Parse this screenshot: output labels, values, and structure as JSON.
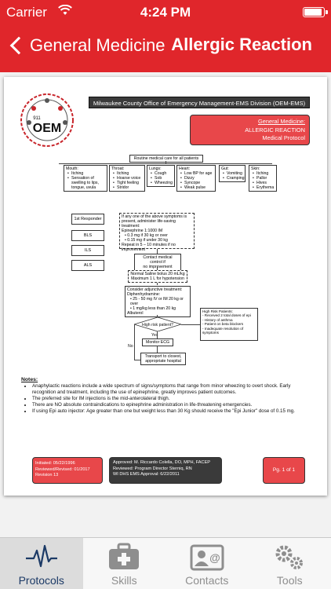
{
  "status": {
    "carrier": "Carrier",
    "time": "4:24 PM",
    "battery_level": 0.95
  },
  "nav": {
    "back_label": "General Medicine",
    "title": "Allergic Reaction"
  },
  "document": {
    "logo_text": "OEM",
    "logo_small": "911",
    "org_banner": "Milwaukee County Office of Emergency Management-EMS Division (OEM-EMS)",
    "protocol_box": {
      "line1": "General Medicine:",
      "line2": "ALLERGIC REACTION",
      "line3": "Medical Protocol"
    },
    "flow": {
      "routine": "Routine medical care for all patients",
      "symptom_groups": [
        {
          "title": "Mouth:",
          "items": [
            "Itching",
            "Sensation of swelling to lips, tongue, uvula"
          ]
        },
        {
          "title": "Throat:",
          "items": [
            "Itching",
            "Hoarse voice",
            "Tight feeling",
            "Stridor"
          ]
        },
        {
          "title": "Lungs:",
          "items": [
            "Cough",
            "Sob",
            "Wheezing"
          ]
        },
        {
          "title": "Heart:",
          "items": [
            "Low BP for age",
            "Dizzy",
            "Syncope",
            "Weak pulse"
          ]
        },
        {
          "title": "Gut:",
          "items": [
            "Vomiting",
            "Cramping"
          ]
        },
        {
          "title": "Skin:",
          "items": [
            "Itching",
            "Pallor",
            "Hives",
            "Erythema"
          ]
        }
      ],
      "responders": [
        "1st Responder",
        "BLS",
        "ILS",
        "ALS"
      ],
      "epi_box": [
        "If any one of the above symptoms is present, administer life-saving treatment:",
        "Epinephrine 1:1000 IM",
        "0.3 mg if 30 kg or over",
        "0.15 mg if under 30 kg",
        "Repeat in 5 – 10 minutes if no improvement"
      ],
      "contact_box": [
        "Contact medical control if",
        "no improvement"
      ],
      "saline_box": [
        "Normal Saline bolus 20 mL/kg",
        "Maximum 1 L for hypotension"
      ],
      "adjunct_box": [
        "Consider adjunctive treatment:",
        "Diphenhydramine:",
        "25 - 50 mg IV or IM 20 kg or over",
        "1 mg/kg less than 20 kg",
        "Albuterol"
      ],
      "decision": "High risk patient?",
      "decision_yes": "Yes",
      "decision_no": "No",
      "monitor": "Monitor ECG",
      "transport": [
        "Transport to closest,",
        "appropriate hospital"
      ],
      "high_risk_title": "High Risk Patients:",
      "high_risk_items": [
        "Received 2 total doses of epi",
        "History of asthma",
        "Patient on beta blockers",
        "Inadequate resolution of symptoms"
      ]
    },
    "notes": {
      "title": "Notes:",
      "items": [
        "Anaphylactic reactions include a wide spectrum of signs/symptoms that range from minor wheezing to overt shock. Early recognition and treatment, including the use of epinephrine, greatly improves patient outcomes.",
        "The preferred site for IM injections is the mid-anterolateral thigh.",
        "There are NO absolute contraindications to epinephrine administration in life-threatening emergencies.",
        "If using Epi auto injector: Age greater than one but weight less than 30 Kg should receive the \"Epi Junior\" dose of 0.15 mg."
      ]
    },
    "footer": {
      "initiated": "Initiated: 05/22/1996",
      "reviewed": "Reviewed/Revised: 01/2017",
      "revision": "Revision 13",
      "approved": "Approved:  M. Riccardo Colella, DO, MPH, FACEP",
      "reviewed_by": "Reviewed:  Program Director Sterniq, RN",
      "wi_approval": "WI DHS EMS Approval:   6/22/2011",
      "page": "Pg. 1 of 1"
    }
  },
  "tabs": [
    {
      "label": "Protocols",
      "icon": "pulse-icon",
      "active": true
    },
    {
      "label": "Skills",
      "icon": "medical-kit-icon",
      "active": false
    },
    {
      "label": "Contacts",
      "icon": "contact-card-icon",
      "active": false
    },
    {
      "label": "Tools",
      "icon": "gears-icon",
      "active": false
    }
  ],
  "colors": {
    "brand_red": "#e0262b",
    "box_red": "#e8474a",
    "dark_box": "#3a3a3a",
    "active_tab": "#1c3a66"
  }
}
